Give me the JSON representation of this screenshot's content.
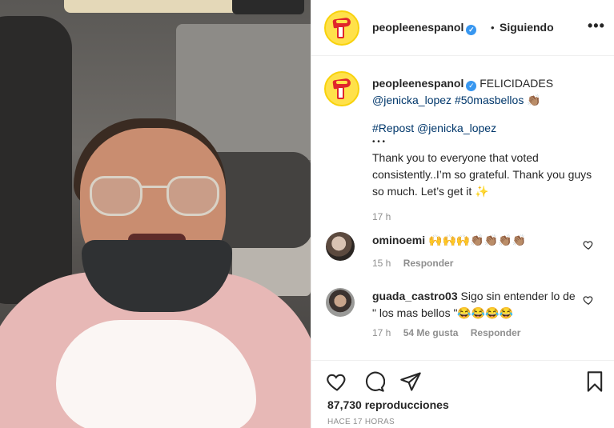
{
  "header": {
    "username": "peopleenespanol",
    "separator": "•",
    "follow_status": "Siguiendo",
    "more_label": "•••"
  },
  "caption": {
    "username": "peopleenespanol",
    "text_lead": "FELICIDADES",
    "mention": "@jenicka_lopez",
    "hashtag": "#50masbellos",
    "emoji_1": "👏🏽",
    "repost_tag": "#Repost",
    "repost_user": "@jenicka_lopez",
    "dots": "• • •",
    "body": "Thank you to everyone that voted consistently..I’m so grateful. Thank you guys so much. Let’s get it",
    "emoji_2": "✨",
    "time": "17 h"
  },
  "comments": [
    {
      "username": "ominoemi",
      "text": "🙌🙌🙌👏🏽👏🏽👏🏽👏🏽",
      "time": "15 h",
      "likes": "",
      "reply_label": "Responder"
    },
    {
      "username": "guada_castro03",
      "text": "Sigo sin entender lo de \" los mas bellos \"😂😂😂😂",
      "time": "17 h",
      "likes": "54 Me gusta",
      "reply_label": "Responder"
    }
  ],
  "actions": {
    "views": "87,730 reproducciones",
    "posted_ago": "HACE 17 HORAS"
  },
  "icons": {
    "like": "heart-icon",
    "comment": "comment-icon",
    "share": "share-icon",
    "save": "bookmark-icon",
    "verified": "verified-badge-icon",
    "comment_like": "heart-icon"
  },
  "colors": {
    "brand_yellow": "#ffe14a",
    "brand_red": "#e0262b",
    "verified_blue": "#3897f0",
    "link_blue": "#00376b",
    "muted_gray": "#8e8e8e"
  }
}
